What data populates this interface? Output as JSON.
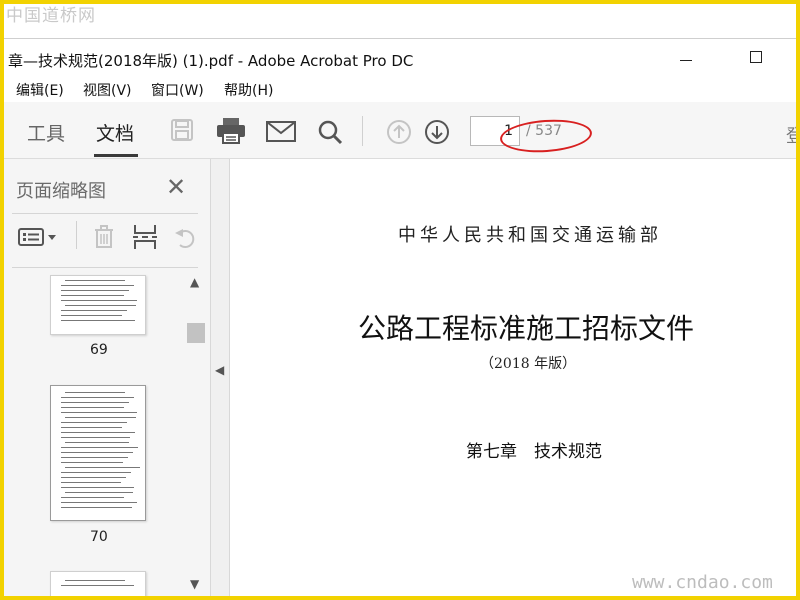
{
  "watermark": {
    "top": "中国道桥网",
    "bottom": "www.cndao.com"
  },
  "window": {
    "title": "章—技术规范(2018年版) (1).pdf - Adobe Acrobat Pro DC"
  },
  "menu": [
    "编辑(E)",
    "视图(V)",
    "窗口(W)",
    "帮助(H)"
  ],
  "toolbar": {
    "tabs": [
      "工具",
      "文档"
    ],
    "active_tab": "文档",
    "icons": [
      "save-icon",
      "print-icon",
      "email-icon",
      "search-icon",
      "page-up-icon",
      "page-down-icon"
    ],
    "page_current": "1",
    "page_total": "/ 537",
    "right_overflow_text": "登"
  },
  "sidebar": {
    "title": "页面缩略图",
    "thumbnails": [
      {
        "page": "69"
      },
      {
        "page": "70"
      },
      {
        "page": ""
      }
    ]
  },
  "document": {
    "ministry": "中华人民共和国交通运输部",
    "title": "公路工程标准施工招标文件",
    "edition": "（2018 年版）",
    "chapter": "第七章　技术规范"
  },
  "colors": {
    "frame": "#f2d200",
    "highlight_oval": "#d82020"
  }
}
